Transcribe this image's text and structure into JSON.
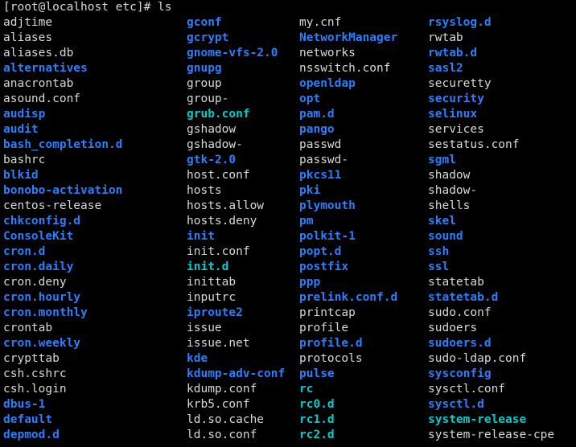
{
  "terminal": {
    "prompt": "[root@localhost etc]# ls",
    "user": "root",
    "host": "localhost",
    "cwd": "etc",
    "command": "ls",
    "colors": {
      "background": "#000000",
      "foreground": "#d8d8d8",
      "directory": "#2a7fff",
      "symlink": "#00cdcd"
    }
  },
  "listing": {
    "columns": [
      {
        "entries": [
          {
            "name": "adjtime",
            "type": "file"
          },
          {
            "name": "aliases",
            "type": "file"
          },
          {
            "name": "aliases.db",
            "type": "file"
          },
          {
            "name": "alternatives",
            "type": "dir"
          },
          {
            "name": "anacrontab",
            "type": "file"
          },
          {
            "name": "asound.conf",
            "type": "file"
          },
          {
            "name": "audisp",
            "type": "dir"
          },
          {
            "name": "audit",
            "type": "dir"
          },
          {
            "name": "bash_completion.d",
            "type": "dir"
          },
          {
            "name": "bashrc",
            "type": "file"
          },
          {
            "name": "blkid",
            "type": "dir"
          },
          {
            "name": "bonobo-activation",
            "type": "dir"
          },
          {
            "name": "centos-release",
            "type": "file"
          },
          {
            "name": "chkconfig.d",
            "type": "dir"
          },
          {
            "name": "ConsoleKit",
            "type": "dir"
          },
          {
            "name": "cron.d",
            "type": "dir"
          },
          {
            "name": "cron.daily",
            "type": "dir"
          },
          {
            "name": "cron.deny",
            "type": "file"
          },
          {
            "name": "cron.hourly",
            "type": "dir"
          },
          {
            "name": "cron.monthly",
            "type": "dir"
          },
          {
            "name": "crontab",
            "type": "file"
          },
          {
            "name": "cron.weekly",
            "type": "dir"
          },
          {
            "name": "crypttab",
            "type": "file"
          },
          {
            "name": "csh.cshrc",
            "type": "file"
          },
          {
            "name": "csh.login",
            "type": "file"
          },
          {
            "name": "dbus-1",
            "type": "dir"
          },
          {
            "name": "default",
            "type": "dir"
          },
          {
            "name": "depmod.d",
            "type": "dir"
          }
        ]
      },
      {
        "entries": [
          {
            "name": "gconf",
            "type": "dir"
          },
          {
            "name": "gcrypt",
            "type": "dir"
          },
          {
            "name": "gnome-vfs-2.0",
            "type": "dir"
          },
          {
            "name": "gnupg",
            "type": "dir"
          },
          {
            "name": "group",
            "type": "file"
          },
          {
            "name": "group-",
            "type": "file"
          },
          {
            "name": "grub.conf",
            "type": "link"
          },
          {
            "name": "gshadow",
            "type": "file"
          },
          {
            "name": "gshadow-",
            "type": "file"
          },
          {
            "name": "gtk-2.0",
            "type": "dir"
          },
          {
            "name": "host.conf",
            "type": "file"
          },
          {
            "name": "hosts",
            "type": "file"
          },
          {
            "name": "hosts.allow",
            "type": "file"
          },
          {
            "name": "hosts.deny",
            "type": "file"
          },
          {
            "name": "init",
            "type": "dir"
          },
          {
            "name": "init.conf",
            "type": "file"
          },
          {
            "name": "init.d",
            "type": "link"
          },
          {
            "name": "inittab",
            "type": "file"
          },
          {
            "name": "inputrc",
            "type": "file"
          },
          {
            "name": "iproute2",
            "type": "dir"
          },
          {
            "name": "issue",
            "type": "file"
          },
          {
            "name": "issue.net",
            "type": "file"
          },
          {
            "name": "kde",
            "type": "dir"
          },
          {
            "name": "kdump-adv-conf",
            "type": "dir"
          },
          {
            "name": "kdump.conf",
            "type": "file"
          },
          {
            "name": "krb5.conf",
            "type": "file"
          },
          {
            "name": "ld.so.cache",
            "type": "file"
          },
          {
            "name": "ld.so.conf",
            "type": "file"
          }
        ]
      },
      {
        "entries": [
          {
            "name": "my.cnf",
            "type": "file"
          },
          {
            "name": "NetworkManager",
            "type": "dir"
          },
          {
            "name": "networks",
            "type": "file"
          },
          {
            "name": "nsswitch.conf",
            "type": "file"
          },
          {
            "name": "openldap",
            "type": "dir"
          },
          {
            "name": "opt",
            "type": "dir"
          },
          {
            "name": "pam.d",
            "type": "dir"
          },
          {
            "name": "pango",
            "type": "dir"
          },
          {
            "name": "passwd",
            "type": "file"
          },
          {
            "name": "passwd-",
            "type": "file"
          },
          {
            "name": "pkcs11",
            "type": "dir"
          },
          {
            "name": "pki",
            "type": "dir"
          },
          {
            "name": "plymouth",
            "type": "dir"
          },
          {
            "name": "pm",
            "type": "dir"
          },
          {
            "name": "polkit-1",
            "type": "dir"
          },
          {
            "name": "popt.d",
            "type": "dir"
          },
          {
            "name": "postfix",
            "type": "dir"
          },
          {
            "name": "ppp",
            "type": "dir"
          },
          {
            "name": "prelink.conf.d",
            "type": "dir"
          },
          {
            "name": "printcap",
            "type": "file"
          },
          {
            "name": "profile",
            "type": "file"
          },
          {
            "name": "profile.d",
            "type": "dir"
          },
          {
            "name": "protocols",
            "type": "file"
          },
          {
            "name": "pulse",
            "type": "dir"
          },
          {
            "name": "rc",
            "type": "link"
          },
          {
            "name": "rc0.d",
            "type": "link"
          },
          {
            "name": "rc1.d",
            "type": "link"
          },
          {
            "name": "rc2.d",
            "type": "link"
          }
        ]
      },
      {
        "entries": [
          {
            "name": "rsyslog.d",
            "type": "dir"
          },
          {
            "name": "rwtab",
            "type": "file"
          },
          {
            "name": "rwtab.d",
            "type": "dir"
          },
          {
            "name": "sasl2",
            "type": "dir"
          },
          {
            "name": "securetty",
            "type": "file"
          },
          {
            "name": "security",
            "type": "dir"
          },
          {
            "name": "selinux",
            "type": "dir"
          },
          {
            "name": "services",
            "type": "file"
          },
          {
            "name": "sestatus.conf",
            "type": "file"
          },
          {
            "name": "sgml",
            "type": "dir"
          },
          {
            "name": "shadow",
            "type": "file"
          },
          {
            "name": "shadow-",
            "type": "file"
          },
          {
            "name": "shells",
            "type": "file"
          },
          {
            "name": "skel",
            "type": "dir"
          },
          {
            "name": "sound",
            "type": "dir"
          },
          {
            "name": "ssh",
            "type": "dir"
          },
          {
            "name": "ssl",
            "type": "dir"
          },
          {
            "name": "statetab",
            "type": "file"
          },
          {
            "name": "statetab.d",
            "type": "dir"
          },
          {
            "name": "sudo.conf",
            "type": "file"
          },
          {
            "name": "sudoers",
            "type": "file"
          },
          {
            "name": "sudoers.d",
            "type": "dir"
          },
          {
            "name": "sudo-ldap.conf",
            "type": "file"
          },
          {
            "name": "sysconfig",
            "type": "dir"
          },
          {
            "name": "sysctl.conf",
            "type": "file"
          },
          {
            "name": "sysctl.d",
            "type": "dir"
          },
          {
            "name": "system-release",
            "type": "link"
          },
          {
            "name": "system-release-cpe",
            "type": "file"
          }
        ]
      }
    ]
  }
}
